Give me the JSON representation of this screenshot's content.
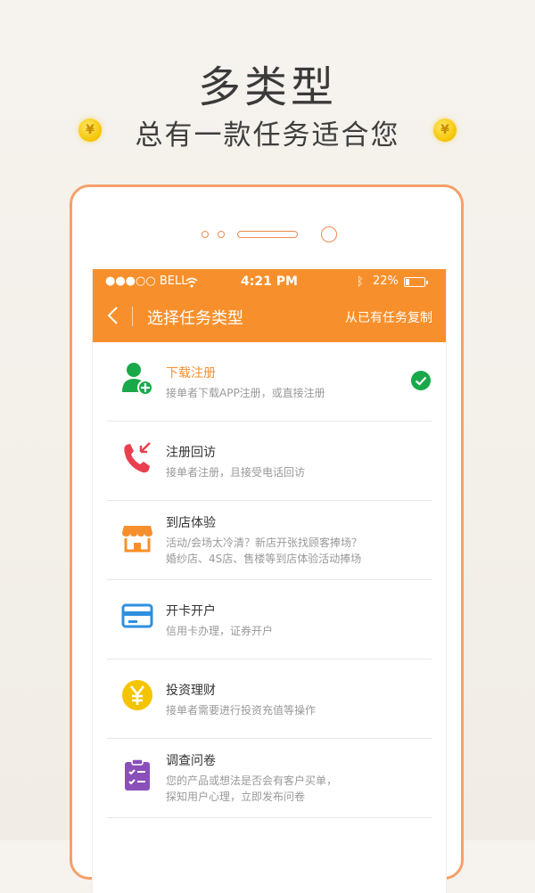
{
  "hero": {
    "title": "多类型",
    "subtitle": "总有一款任务适合您",
    "coin_symbol": "¥"
  },
  "status_bar": {
    "carrier": "●●●○○ BELL",
    "time": "4:21 PM",
    "battery": "22%",
    "battery_level": 0.22
  },
  "nav": {
    "title": "选择任务类型",
    "action": "从已有任务复制"
  },
  "tasks": [
    {
      "title": "下载注册",
      "desc": "接单者下载APP注册，或直接注册",
      "selected": true,
      "icon": "user-add-icon",
      "color": "#1aa84a"
    },
    {
      "title": "注册回访",
      "desc": "接单者注册，且接受电话回访",
      "selected": false,
      "icon": "phone-callback-icon",
      "color": "#e8404f"
    },
    {
      "title": "到店体验",
      "desc": "活动/会场太冷清？新店开张找顾客捧场？",
      "desc2": "婚纱店、4S店、售楼等到店体验活动捧场",
      "selected": false,
      "icon": "store-icon",
      "color": "#f7902c"
    },
    {
      "title": "开卡开户",
      "desc": "信用卡办理，证券开户",
      "selected": false,
      "icon": "card-icon",
      "color": "#2e8fe0"
    },
    {
      "title": "投资理财",
      "desc": "接单者需要进行投资充值等操作",
      "selected": false,
      "icon": "yen-coin-icon",
      "color": "#f5c400"
    },
    {
      "title": "调查问卷",
      "desc": "您的产品或想法是否会有客户买单，",
      "desc2": "探知用户心理，立即发布问卷",
      "selected": false,
      "icon": "questionnaire-icon",
      "color": "#8a4fb8"
    }
  ]
}
